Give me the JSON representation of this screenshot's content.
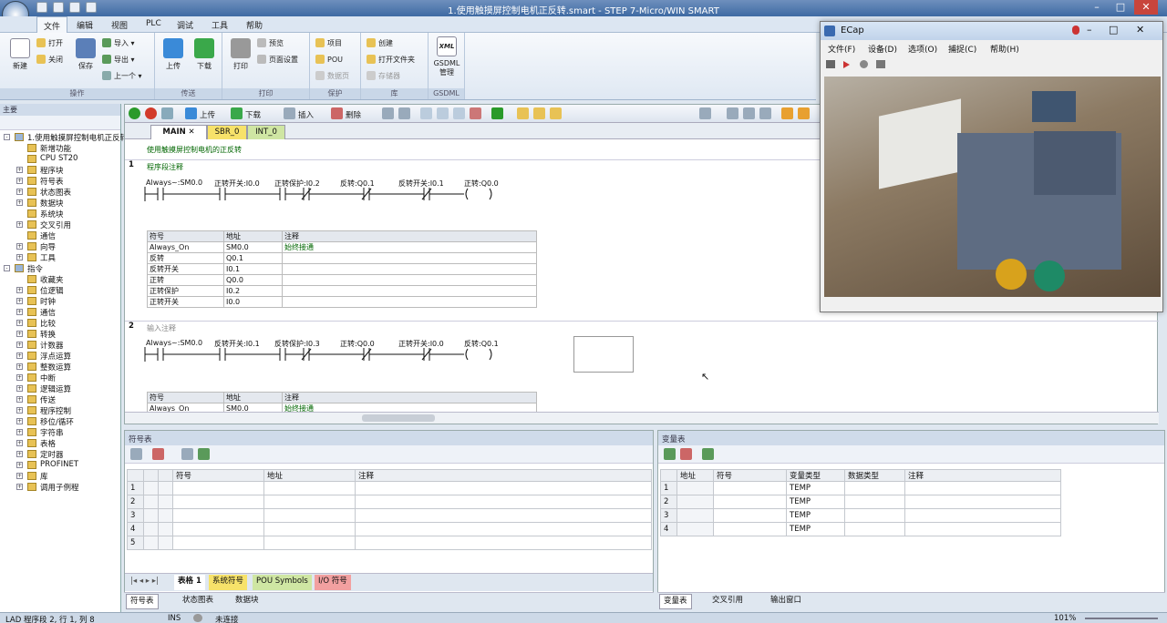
{
  "window": {
    "title": "1.使用触摸屏控制电机正反转.smart - STEP 7-Micro/WIN SMART"
  },
  "menu": [
    "文件",
    "编辑",
    "视图",
    "PLC",
    "调试",
    "工具",
    "帮助"
  ],
  "ribbon": {
    "new": "新建",
    "open": "打开",
    "close": "关闭",
    "save": "保存",
    "import": "导入",
    "export": "导出",
    "prev": "上一个",
    "upload": "上传",
    "download": "下载",
    "print": "打印",
    "preview": "预览",
    "page_setup": "页面设置",
    "project": "项目",
    "pou": "POU",
    "data_page": "数据页",
    "create": "创建",
    "open_folder": "打开文件夹",
    "memory_card": "存储器",
    "xml": "XML",
    "gsdml": "GSDML",
    "gsdml_manage": "管理",
    "groups": [
      "操作",
      "传送",
      "打印",
      "保护",
      "库",
      "GSDML"
    ]
  },
  "left_panel": {
    "title": "主要",
    "tree": [
      {
        "label": "1.使用触摸屏控制电机正反转",
        "lvl": 0,
        "exp": "-"
      },
      {
        "label": "新增功能",
        "lvl": 1,
        "exp": ""
      },
      {
        "label": "CPU ST20",
        "lvl": 1,
        "exp": ""
      },
      {
        "label": "程序块",
        "lvl": 1,
        "exp": "+"
      },
      {
        "label": "符号表",
        "lvl": 1,
        "exp": "+"
      },
      {
        "label": "状态图表",
        "lvl": 1,
        "exp": "+"
      },
      {
        "label": "数据块",
        "lvl": 1,
        "exp": "+"
      },
      {
        "label": "系统块",
        "lvl": 1,
        "exp": ""
      },
      {
        "label": "交叉引用",
        "lvl": 1,
        "exp": "+"
      },
      {
        "label": "通信",
        "lvl": 1,
        "exp": ""
      },
      {
        "label": "向导",
        "lvl": 1,
        "exp": "+"
      },
      {
        "label": "工具",
        "lvl": 1,
        "exp": "+"
      },
      {
        "label": "指令",
        "lvl": 0,
        "exp": "-"
      },
      {
        "label": "收藏夹",
        "lvl": 1,
        "exp": ""
      },
      {
        "label": "位逻辑",
        "lvl": 1,
        "exp": "+"
      },
      {
        "label": "时钟",
        "lvl": 1,
        "exp": "+"
      },
      {
        "label": "通信",
        "lvl": 1,
        "exp": "+"
      },
      {
        "label": "比较",
        "lvl": 1,
        "exp": "+"
      },
      {
        "label": "转换",
        "lvl": 1,
        "exp": "+"
      },
      {
        "label": "计数器",
        "lvl": 1,
        "exp": "+"
      },
      {
        "label": "浮点运算",
        "lvl": 1,
        "exp": "+"
      },
      {
        "label": "整数运算",
        "lvl": 1,
        "exp": "+"
      },
      {
        "label": "中断",
        "lvl": 1,
        "exp": "+"
      },
      {
        "label": "逻辑运算",
        "lvl": 1,
        "exp": "+"
      },
      {
        "label": "传送",
        "lvl": 1,
        "exp": "+"
      },
      {
        "label": "程序控制",
        "lvl": 1,
        "exp": "+"
      },
      {
        "label": "移位/循环",
        "lvl": 1,
        "exp": "+"
      },
      {
        "label": "字符串",
        "lvl": 1,
        "exp": "+"
      },
      {
        "label": "表格",
        "lvl": 1,
        "exp": "+"
      },
      {
        "label": "定时器",
        "lvl": 1,
        "exp": "+"
      },
      {
        "label": "PROFINET",
        "lvl": 1,
        "exp": "+"
      },
      {
        "label": "库",
        "lvl": 1,
        "exp": "+"
      },
      {
        "label": "调用子例程",
        "lvl": 1,
        "exp": "+"
      }
    ]
  },
  "editor": {
    "toolbar": {
      "upload": "上传",
      "download": "下载",
      "insert": "插入",
      "delete": "删除"
    },
    "tabs": [
      "MAIN",
      "SBR_0",
      "INT_0"
    ],
    "program_comment": "使用触摸屏控制电机的正反转",
    "networks": [
      {
        "num": "1",
        "comment": "程序段注释",
        "labels": [
          "Always~:SM0.0",
          "正转开关:I0.0",
          "正转保护:I0.2",
          "反转:Q0.1",
          "反转开关:I0.1",
          "正转:Q0.0"
        ],
        "symbols": [
          [
            "Always_On",
            "SM0.0",
            "始终接通"
          ],
          [
            "反转",
            "Q0.1",
            ""
          ],
          [
            "反转开关",
            "I0.1",
            ""
          ],
          [
            "正转",
            "Q0.0",
            ""
          ],
          [
            "正转保护",
            "I0.2",
            ""
          ],
          [
            "正转开关",
            "I0.0",
            ""
          ]
        ]
      },
      {
        "num": "2",
        "comment": "输入注释",
        "labels": [
          "Always~:SM0.0",
          "反转开关:I0.1",
          "反转保护:I0.3",
          "正转:Q0.0",
          "正转开关:I0.0",
          "反转:Q0.1"
        ],
        "symbols": [
          [
            "Always_On",
            "SM0.0",
            "始终接通"
          ]
        ]
      }
    ],
    "symbol_header": [
      "符号",
      "地址",
      "注释"
    ]
  },
  "symbol_pane": {
    "title": "符号表",
    "headers": [
      "符号",
      "地址",
      "注释"
    ],
    "rows": [
      "1",
      "2",
      "3",
      "4",
      "5"
    ],
    "tabs": [
      "表格 1",
      "系统符号",
      "POU Symbols",
      "I/O 符号"
    ]
  },
  "var_pane": {
    "title": "变量表",
    "headers": [
      "地址",
      "符号",
      "变量类型",
      "数据类型",
      "注释"
    ],
    "rows": [
      {
        "n": "1",
        "type": "TEMP"
      },
      {
        "n": "2",
        "type": "TEMP"
      },
      {
        "n": "3",
        "type": "TEMP"
      },
      {
        "n": "4",
        "type": "TEMP"
      }
    ]
  },
  "bottom_tabs_left": [
    "符号表",
    "状态图表",
    "数据块"
  ],
  "bottom_tabs_right": [
    "变量表",
    "交叉引用",
    "输出窗口"
  ],
  "status": {
    "pos": "LAD 程序段 2, 行 1, 列 8",
    "mode": "INS",
    "conn": "未连接",
    "zoom": "101%"
  },
  "ecap": {
    "title": "ECap",
    "menu": [
      "文件(F)",
      "设备(D)",
      "选项(O)",
      "捕捉(C)",
      "帮助(H)"
    ]
  }
}
